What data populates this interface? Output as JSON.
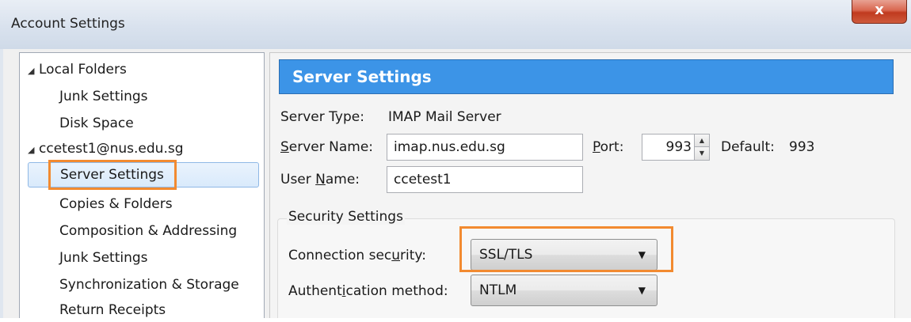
{
  "window": {
    "title": "Account Settings",
    "close_label": "x"
  },
  "tree": {
    "items": [
      {
        "label": "Local Folders",
        "expander": "◢"
      },
      {
        "label": "Junk Settings"
      },
      {
        "label": "Disk Space"
      },
      {
        "label": "ccetest1@nus.edu.sg",
        "expander": "◢"
      },
      {
        "label": "Server Settings",
        "selected": true
      },
      {
        "label": "Copies & Folders"
      },
      {
        "label": "Composition & Addressing"
      },
      {
        "label": "Junk Settings"
      },
      {
        "label": "Synchronization & Storage"
      },
      {
        "label": "Return Receipts"
      }
    ]
  },
  "panel": {
    "header": "Server Settings",
    "server_type_label": "Server Type:",
    "server_type_value": "IMAP Mail Server",
    "server_name_label_u": "S",
    "server_name_label_rest": "erver Name:",
    "server_name_value": "imap.nus.edu.sg",
    "port_label_u": "P",
    "port_label_rest": "ort:",
    "port_value": "993",
    "default_label": "Default:",
    "default_value": "993",
    "user_name_label_pre": "User ",
    "user_name_label_u": "N",
    "user_name_label_rest": "ame:",
    "user_name_value": "ccetest1"
  },
  "security": {
    "group_title": "Security Settings",
    "connection_label_pre": "Connection sec",
    "connection_label_u": "u",
    "connection_label_rest": "rity:",
    "connection_value": "SSL/TLS",
    "auth_label_pre": "Authent",
    "auth_label_u": "i",
    "auth_label_rest": "cation method:",
    "auth_value": "NTLM"
  },
  "colors": {
    "header_bg": "#3c94e7",
    "highlight": "#f28a30"
  }
}
